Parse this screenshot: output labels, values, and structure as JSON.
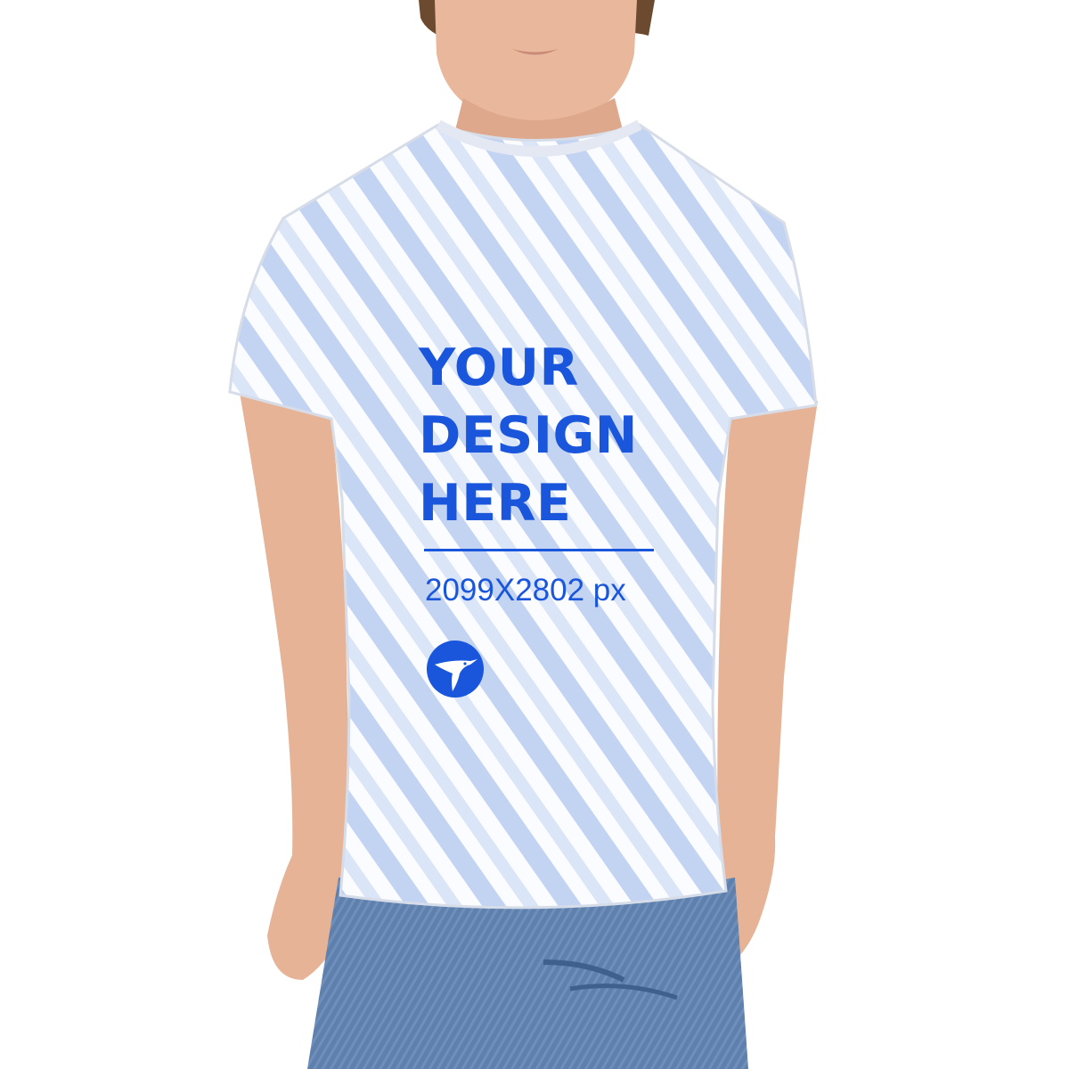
{
  "photo": {
    "subject": "child-wearing-printed-tshirt",
    "colors": {
      "background": "#ffffff",
      "skin": "#e9b79b",
      "hair": "#6b4a30",
      "shirt": "#fbfcff",
      "stripe": "#b7c9ef",
      "jeans": "#5d7fae",
      "print": "#1a56db"
    }
  },
  "print": {
    "headline_lines": [
      "YOUR",
      "DESIGN",
      "HERE"
    ],
    "dimensions": "2099X2802 px",
    "logo_icon": "hummingbird-icon"
  }
}
